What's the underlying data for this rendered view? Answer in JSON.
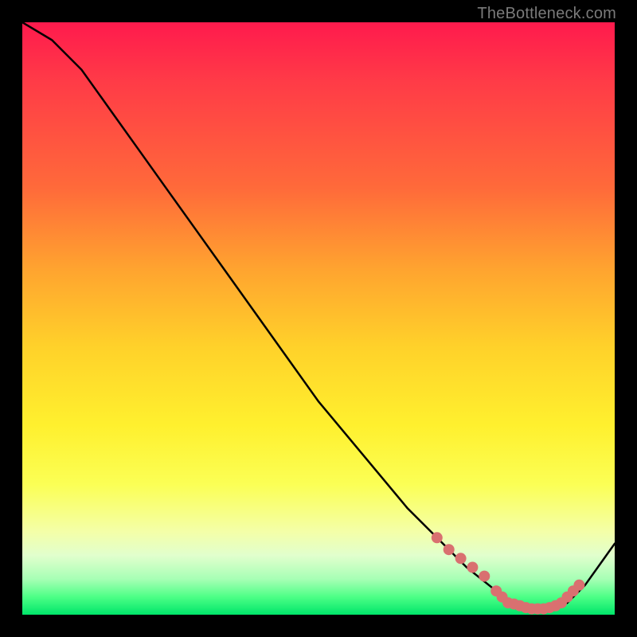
{
  "attribution": "TheBottleneck.com",
  "chart_data": {
    "type": "line",
    "title": "",
    "xlabel": "",
    "ylabel": "",
    "xlim": [
      0,
      100
    ],
    "ylim": [
      0,
      100
    ],
    "series": [
      {
        "name": "bottleneck-curve",
        "x": [
          0,
          5,
          10,
          15,
          20,
          25,
          30,
          35,
          40,
          45,
          50,
          55,
          60,
          65,
          70,
          75,
          80,
          82,
          85,
          88,
          90,
          92,
          95,
          100
        ],
        "y": [
          100,
          97,
          92,
          85,
          78,
          71,
          64,
          57,
          50,
          43,
          36,
          30,
          24,
          18,
          13,
          8,
          4,
          2,
          1,
          1,
          1,
          2,
          5,
          12
        ]
      }
    ],
    "markers": {
      "name": "highlight-segment",
      "x": [
        70,
        72,
        74,
        76,
        78,
        80,
        81,
        82,
        83,
        84,
        85,
        86,
        87,
        88,
        89,
        90,
        91,
        92,
        93,
        94
      ],
      "y": [
        13,
        11,
        9.5,
        8,
        6.5,
        4,
        3,
        2,
        1.8,
        1.5,
        1.2,
        1,
        1,
        1,
        1.2,
        1.5,
        2,
        3,
        4,
        5
      ]
    }
  }
}
